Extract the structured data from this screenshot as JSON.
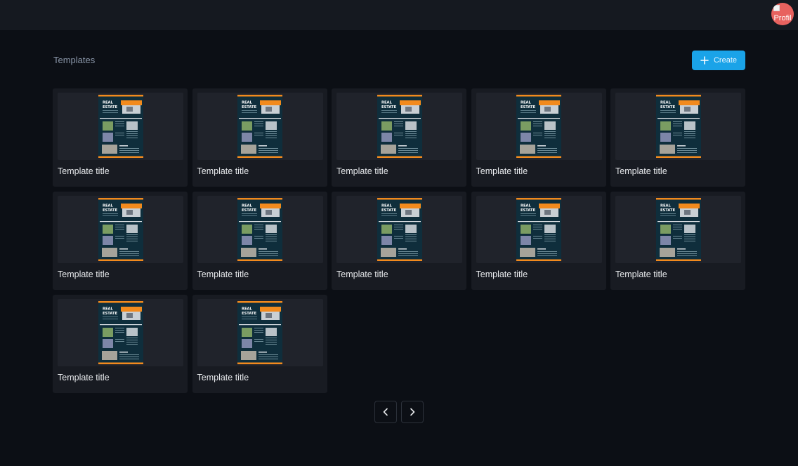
{
  "header": {
    "avatar_alt": "Profil"
  },
  "page": {
    "title": "Templates",
    "create_label": "Create"
  },
  "flyer": {
    "headline_1": "REAL",
    "headline_2": "ESTATE"
  },
  "templates": [
    {
      "title": "Template title"
    },
    {
      "title": "Template title"
    },
    {
      "title": "Template title"
    },
    {
      "title": "Template title"
    },
    {
      "title": "Template title"
    },
    {
      "title": "Template title"
    },
    {
      "title": "Template title"
    },
    {
      "title": "Template title"
    },
    {
      "title": "Template title"
    },
    {
      "title": "Template title"
    },
    {
      "title": "Template title"
    },
    {
      "title": "Template title"
    }
  ],
  "colors": {
    "accent": "#1aa3e8",
    "flyer_bg": "#0f2e3c",
    "flyer_orange": "#f28a1d"
  },
  "icons": {
    "create": "plus-icon",
    "prev": "chevron-left-icon",
    "next": "chevron-right-icon"
  }
}
